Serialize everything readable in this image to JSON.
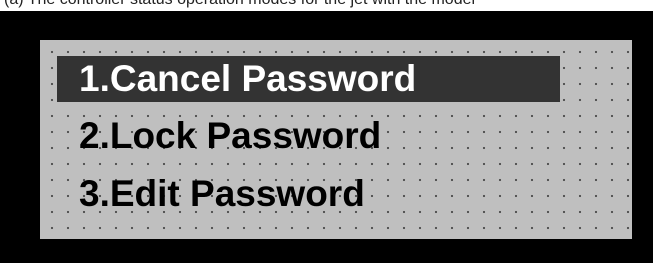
{
  "caption": {
    "text": "(a) The controller status operation modes for the jet with the model"
  },
  "menu": {
    "items": [
      {
        "label": "1.Cancel Password",
        "selected": true
      },
      {
        "label": "2.Lock Password",
        "selected": false
      },
      {
        "label": "3.Edit Password",
        "selected": false
      }
    ]
  },
  "colors": {
    "frame": "#000000",
    "screen": "#bfbfbf",
    "highlight": "#333333",
    "highlight_text": "#ffffff",
    "text": "#000000"
  }
}
